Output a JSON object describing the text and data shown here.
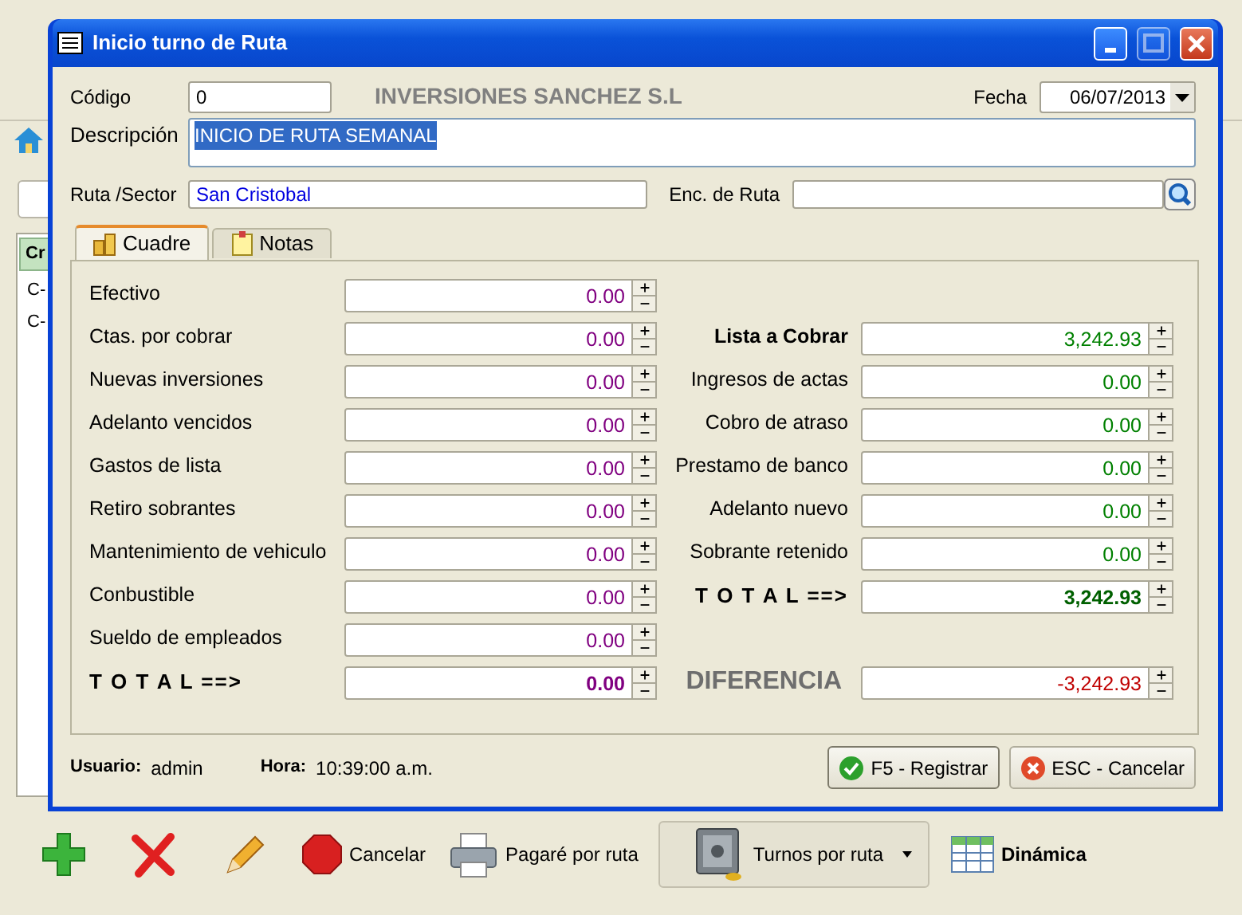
{
  "background": {
    "list_header": "Cr",
    "list_rows": [
      "C-",
      "C-"
    ]
  },
  "toolbar": [
    {
      "kind": "add"
    },
    {
      "kind": "delete"
    },
    {
      "kind": "edit"
    },
    {
      "kind": "stop",
      "label": "Cancelar",
      "bold": false,
      "raised": false
    },
    {
      "kind": "print",
      "label": "Pagaré por ruta",
      "bold": false,
      "raised": false
    },
    {
      "kind": "safe",
      "label": "Turnos por ruta",
      "bold": false,
      "raised": true
    },
    {
      "kind": "grid",
      "label": "Dinámica",
      "bold": true,
      "raised": false
    }
  ],
  "dialog": {
    "title": "Inicio turno de Ruta",
    "codigo": {
      "label": "Código",
      "value": "0"
    },
    "company": "INVERSIONES SANCHEZ S.L",
    "fecha": {
      "label": "Fecha",
      "value": "06/07/2013"
    },
    "descripcion": {
      "label": "Descripción",
      "value": "INICIO DE RUTA SEMANAL",
      "selected": true
    },
    "ruta": {
      "label": "Ruta /Sector",
      "value": "San Cristobal"
    },
    "encargado": {
      "label": "Enc. de Ruta"
    },
    "tabs": [
      {
        "label": "Cuadre",
        "selected": true
      },
      {
        "label": "Notas",
        "selected": false
      }
    ],
    "left": [
      {
        "label": "Efectivo",
        "value": "0.00",
        "kind": "normal"
      },
      {
        "label": "Ctas. por cobrar",
        "value": "0.00",
        "kind": "normal"
      },
      {
        "label": "Nuevas inversiones",
        "value": "0.00",
        "kind": "normal"
      },
      {
        "label": "Adelanto vencidos",
        "value": "0.00",
        "kind": "normal"
      },
      {
        "label": "Gastos de lista",
        "value": "0.00",
        "kind": "normal"
      },
      {
        "label": "Retiro sobrantes",
        "value": "0.00",
        "kind": "normal"
      },
      {
        "label": "Mantenimiento de vehiculo",
        "value": "0.00",
        "kind": "normal"
      },
      {
        "label": "Conbustible",
        "value": "0.00",
        "kind": "normal"
      },
      {
        "label": "Sueldo de empleados",
        "value": "0.00",
        "kind": "normal"
      },
      {
        "label": "T O T A L ==>",
        "value": "0.00",
        "kind": "total"
      }
    ],
    "right": [
      {
        "label": "Lista a Cobrar",
        "value": "3,242.93",
        "kind": "heading"
      },
      {
        "label": "Ingresos de actas",
        "value": "0.00",
        "kind": "normal"
      },
      {
        "label": "Cobro de atraso",
        "value": "0.00",
        "kind": "normal"
      },
      {
        "label": "Prestamo de banco",
        "value": "0.00",
        "kind": "normal"
      },
      {
        "label": "Adelanto nuevo",
        "value": "0.00",
        "kind": "normal"
      },
      {
        "label": "Sobrante retenido",
        "value": "0.00",
        "kind": "normal"
      },
      {
        "label": "T O T A L ==>",
        "value": "3,242.93",
        "kind": "total"
      }
    ],
    "difference": {
      "label": "DIFERENCIA",
      "value": "-3,242.93"
    },
    "status": {
      "user_label": "Usuario:",
      "user": "admin",
      "time_label": "Hora:",
      "time": "10:39:00 a.m."
    },
    "buttons": [
      {
        "kind": "ok",
        "label": "F5 - Registrar"
      },
      {
        "kind": "cancel",
        "label": "ESC - Cancelar"
      }
    ]
  }
}
